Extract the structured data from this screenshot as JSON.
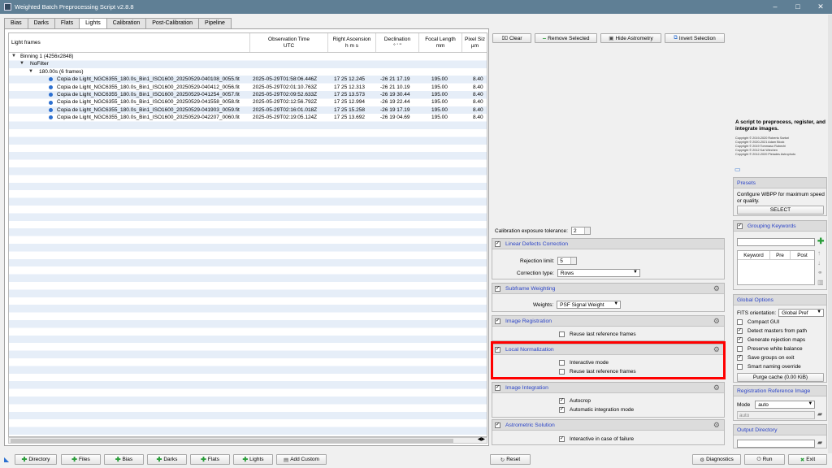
{
  "window": {
    "title": "Weighted Batch Preprocessing Script v2.8.8",
    "minimize": "–",
    "maximize": "□",
    "close": "✕"
  },
  "tabs": [
    "Bias",
    "Darks",
    "Flats",
    "Lights",
    "Calibration",
    "Post-Calibration",
    "Pipeline"
  ],
  "active_tab": "Lights",
  "table": {
    "columns": {
      "frames": "Light frames",
      "obs_time": "Observation Time",
      "obs_time_sub": "UTC",
      "ra": "Right Ascension",
      "ra_sub": "h   m   s",
      "dec": "Declination",
      "dec_sub": "°   '   \"",
      "focal": "Focal Length",
      "focal_sub": "mm",
      "pixel": "Pixel Siz",
      "pixel_sub": "µm"
    },
    "group1": "Binning 1 (4256x2848)",
    "group2": "NoFilter",
    "group3": "180.00s (6 frames)",
    "rows": [
      {
        "file": "Copia de Light_NGC6355_180.0s_Bin1_ISO1600_20250529-040108_0055.fit",
        "time": "2025-05-29T01:58:06.446Z",
        "ra": "17 25 12.245",
        "dec": "-26 21 17.19",
        "focal": "195.00",
        "pixel": "8.40"
      },
      {
        "file": "Copia de Light_NGC6355_180.0s_Bin1_ISO1600_20250529-040412_0056.fit",
        "time": "2025-05-29T02:01:10.763Z",
        "ra": "17 25 12.313",
        "dec": "-26 21 10.19",
        "focal": "195.00",
        "pixel": "8.40"
      },
      {
        "file": "Copia de Light_NGC6355_180.0s_Bin1_ISO1600_20250529-041254_0057.fit",
        "time": "2025-05-29T02:09:52.633Z",
        "ra": "17 25 13.573",
        "dec": "-26 19 30.44",
        "focal": "195.00",
        "pixel": "8.40"
      },
      {
        "file": "Copia de Light_NGC6355_180.0s_Bin1_ISO1600_20250529-041558_0058.fit",
        "time": "2025-05-29T02:12:56.792Z",
        "ra": "17 25 12.994",
        "dec": "-26 19 22.44",
        "focal": "195.00",
        "pixel": "8.40"
      },
      {
        "file": "Copia de Light_NGC6355_180.0s_Bin1_ISO1600_20250529-041903_0059.fit",
        "time": "2025-05-29T02:16:01.018Z",
        "ra": "17 25 15.258",
        "dec": "-26 19 17.19",
        "focal": "195.00",
        "pixel": "8.40"
      },
      {
        "file": "Copia de Light_NGC6355_180.0s_Bin1_ISO1600_20250529-042207_0060.fit",
        "time": "2025-05-29T02:19:05.124Z",
        "ra": "17 25 13.692",
        "dec": "-26 19 04.69",
        "focal": "195.00",
        "pixel": "8.40"
      }
    ]
  },
  "toolbar": {
    "clear": "Clear",
    "remove": "Remove Selected",
    "hide": "Hide Astrometry",
    "invert": "Invert Selection"
  },
  "calib": {
    "label": "Calibration exposure tolerance:",
    "value": "2"
  },
  "ldc": {
    "title": "Linear Defects Correction",
    "rej_label": "Rejection limit:",
    "rej_value": "5",
    "type_label": "Correction type:",
    "type_value": "Rows"
  },
  "subframe": {
    "title": "Subframe Weighting",
    "weights_label": "Weights:",
    "weights_value": "PSF Signal Weight"
  },
  "registration": {
    "title": "Image Registration",
    "reuse": "Reuse last reference frames"
  },
  "localnorm": {
    "title": "Local Normalization",
    "interactive": "Interactive mode",
    "reuse": "Reuse last reference frames"
  },
  "integration": {
    "title": "Image Integration",
    "autocrop": "Autocrop",
    "auto": "Automatic integration mode"
  },
  "astro": {
    "title": "Astrometric Solution",
    "interactive": "Interactive in case of failure"
  },
  "about": {
    "desc": "A script to preprocess, register, and integrate images.",
    "c1": "Copyright © 2019-2020 Roberto Sartori",
    "c2": "Copyright © 2020-2021 Adam Block",
    "c3": "Copyright © 2019 Tommaso Rubechi",
    "c4": "Copyright © 2012 Kai Wiechen",
    "c5": "Copyright © 2012-2020 Pleiades Astrophoto"
  },
  "presets": {
    "title": "Presets",
    "desc": "Configure WBPP for maximum speed or quality.",
    "button": "SELECT"
  },
  "grouping": {
    "title": "Grouping Keywords",
    "col1": "Keyword",
    "col2": "Pre",
    "col3": "Post"
  },
  "global": {
    "title": "Global Options",
    "fits_label": "FITS orientation:",
    "fits_value": "Global Pref",
    "opts": [
      "Compact GUI",
      "Detect masters from path",
      "Generate rejection maps",
      "Preserve white balance",
      "Save groups on exit",
      "Smart naming override"
    ],
    "purge": "Purge cache (0.00 KiB)"
  },
  "regref": {
    "title": "Registration Reference Image",
    "mode_label": "Mode",
    "mode_value": "auto",
    "value": "auto"
  },
  "outdir": {
    "title": "Output Directory"
  },
  "bottom": {
    "directory": "Directory",
    "files": "Files",
    "bias": "Bias",
    "darks": "Darks",
    "flats": "Flats",
    "lights": "Lights",
    "custom": "Add Custom",
    "reset": "Reset",
    "diagnostics": "Diagnostics",
    "run": "Run",
    "exit": "Exit"
  }
}
